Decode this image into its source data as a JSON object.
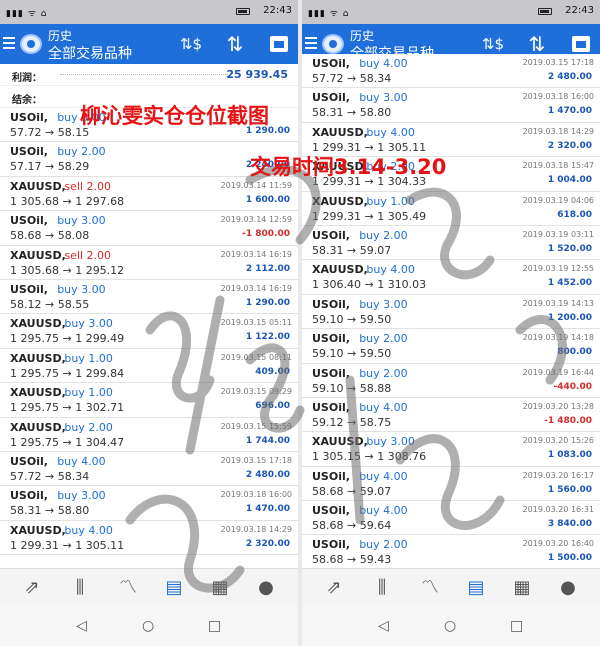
{
  "status_bar": {
    "time": "22:43",
    "signal": "▮▮▮ ᯤ ⌂"
  },
  "app_bar": {
    "title": "历史",
    "subtitle": "全部交易品种"
  },
  "icons": {
    "menu": "menu-icon",
    "logo": "app-logo-icon",
    "money": "money-transfer-icon",
    "sort": "sort-icon",
    "calendar": "calendar-icon",
    "nav": [
      "trade-icon",
      "chart-icon",
      "graph-icon",
      "history-icon",
      "news-icon",
      "chat-icon"
    ]
  },
  "glyphs": {
    "money": "⇅$",
    "sort": "⇅",
    "nav": [
      "⇗",
      "⫼",
      "〽",
      "▤",
      "▦",
      "●"
    ],
    "back": "◁",
    "home": "○",
    "recent": "□"
  },
  "summary": {
    "profit_label": "利润：",
    "profit_value": "25 939.45",
    "balance_label": "结余："
  },
  "overlay": {
    "title": "柳沁雯实仓仓位截图",
    "period": "交易时间3.14-3.20"
  },
  "colors": {
    "accent": "#1e6fd9",
    "profit": "#1a56b5",
    "loss": "#d62b2b",
    "overlay": "#e51313"
  },
  "left_trades": [
    {
      "symbol": "USOil,",
      "side": "buy 3.00",
      "sell": false,
      "prices": "57.72 → 58.15",
      "date": "",
      "profit": "1 290.00"
    },
    {
      "symbol": "USOil,",
      "side": "buy 2.00",
      "sell": false,
      "prices": "57.17 → 58.29",
      "date": "",
      "profit": "2 240.00"
    },
    {
      "symbol": "XAUUSD,",
      "side": "sell 2.00",
      "sell": true,
      "prices": "1 305.68 → 1 297.68",
      "date": "2019.03.14 11:59",
      "profit": "1 600.00"
    },
    {
      "symbol": "USOil,",
      "side": "buy 3.00",
      "sell": false,
      "prices": "58.68 → 58.08",
      "date": "2019.03.14 12:59",
      "profit": "-1 800.00"
    },
    {
      "symbol": "XAUUSD,",
      "side": "sell 2.00",
      "sell": true,
      "prices": "1 305.68 → 1 295.12",
      "date": "2019.03.14 16:19",
      "profit": "2 112.00"
    },
    {
      "symbol": "USOil,",
      "side": "buy 3.00",
      "sell": false,
      "prices": "58.12 → 58.55",
      "date": "2019.03.14 16:19",
      "profit": "1 290.00"
    },
    {
      "symbol": "XAUUSD,",
      "side": "buy 3.00",
      "sell": false,
      "prices": "1 295.75 → 1 299.49",
      "date": "2019.03.15 05:11",
      "profit": "1 122.00"
    },
    {
      "symbol": "XAUUSD,",
      "side": "buy 1.00",
      "sell": false,
      "prices": "1 295.75 → 1 299.84",
      "date": "2019.03.15 08:11",
      "profit": "409.00"
    },
    {
      "symbol": "XAUUSD,",
      "side": "buy 1.00",
      "sell": false,
      "prices": "1 295.75 → 1 302.71",
      "date": "2019.03.15 09:29",
      "profit": "696.00"
    },
    {
      "symbol": "XAUUSD,",
      "side": "buy 2.00",
      "sell": false,
      "prices": "1 295.75 → 1 304.47",
      "date": "2019.03.15 15:59",
      "profit": "1 744.00"
    },
    {
      "symbol": "USOil,",
      "side": "buy 4.00",
      "sell": false,
      "prices": "57.72 → 58.34",
      "date": "2019.03.15 17:18",
      "profit": "2 480.00"
    },
    {
      "symbol": "USOil,",
      "side": "buy 3.00",
      "sell": false,
      "prices": "58.31 → 58.80",
      "date": "2019.03.18 16:00",
      "profit": "1 470.00"
    },
    {
      "symbol": "XAUUSD,",
      "side": "buy 4.00",
      "sell": false,
      "prices": "1 299.31 → 1 305.11",
      "date": "2019.03.18 14:29",
      "profit": "2 320.00"
    }
  ],
  "right_trades": [
    {
      "symbol": "USOil,",
      "side": "buy 4.00",
      "sell": false,
      "prices": "57.72 → 58.34",
      "date": "2019.03.15 17:18",
      "profit": "2 480.00"
    },
    {
      "symbol": "USOil,",
      "side": "buy 3.00",
      "sell": false,
      "prices": "58.31 → 58.80",
      "date": "2019.03.18 16:00",
      "profit": "1 470.00"
    },
    {
      "symbol": "XAUUSD,",
      "side": "buy 4.00",
      "sell": false,
      "prices": "1 299.31 → 1 305.11",
      "date": "2019.03.18 14:29",
      "profit": "2 320.00"
    },
    {
      "symbol": "XAUUSD,",
      "side": "buy 2.00",
      "sell": false,
      "prices": "1 299.31 → 1 304.33",
      "date": "2019.03.18 15:47",
      "profit": "1 004.00"
    },
    {
      "symbol": "XAUUSD,",
      "side": "buy 1.00",
      "sell": false,
      "prices": "1 299.31 → 1 305.49",
      "date": "2019.03.19 04:06",
      "profit": "618.00"
    },
    {
      "symbol": "USOil,",
      "side": "buy 2.00",
      "sell": false,
      "prices": "58.31 → 59.07",
      "date": "2019.03.19 03:11",
      "profit": "1 520.00"
    },
    {
      "symbol": "XAUUSD,",
      "side": "buy 4.00",
      "sell": false,
      "prices": "1 306.40 → 1 310.03",
      "date": "2019.03.19 12:55",
      "profit": "1 452.00"
    },
    {
      "symbol": "USOil,",
      "side": "buy 3.00",
      "sell": false,
      "prices": "59.10 → 59.50",
      "date": "2019.03.19 14:13",
      "profit": "1 200.00"
    },
    {
      "symbol": "USOil,",
      "side": "buy 2.00",
      "sell": false,
      "prices": "59.10 → 59.50",
      "date": "2019.03.19 14:18",
      "profit": "800.00"
    },
    {
      "symbol": "USOil,",
      "side": "buy 2.00",
      "sell": false,
      "prices": "59.10 → 58.88",
      "date": "2019.03.19 16:44",
      "profit": "-440.00"
    },
    {
      "symbol": "USOil,",
      "side": "buy 4.00",
      "sell": false,
      "prices": "59.12 → 58.75",
      "date": "2019.03.20 13:28",
      "profit": "-1 480.00"
    },
    {
      "symbol": "XAUUSD,",
      "side": "buy 3.00",
      "sell": false,
      "prices": "1 305.15 → 1 308.76",
      "date": "2019.03.20 15:26",
      "profit": "1 083.00"
    },
    {
      "symbol": "USOil,",
      "side": "buy 4.00",
      "sell": false,
      "prices": "58.68 → 59.07",
      "date": "2019.03.20 16:17",
      "profit": "1 560.00"
    },
    {
      "symbol": "USOil,",
      "side": "buy 4.00",
      "sell": false,
      "prices": "58.68 → 59.64",
      "date": "2019.03.20 16:31",
      "profit": "3 840.00"
    },
    {
      "symbol": "USOil,",
      "side": "buy 2.00",
      "sell": false,
      "prices": "58.68 → 59.43",
      "date": "2019.03.20 16:40",
      "profit": "1 500.00"
    }
  ]
}
